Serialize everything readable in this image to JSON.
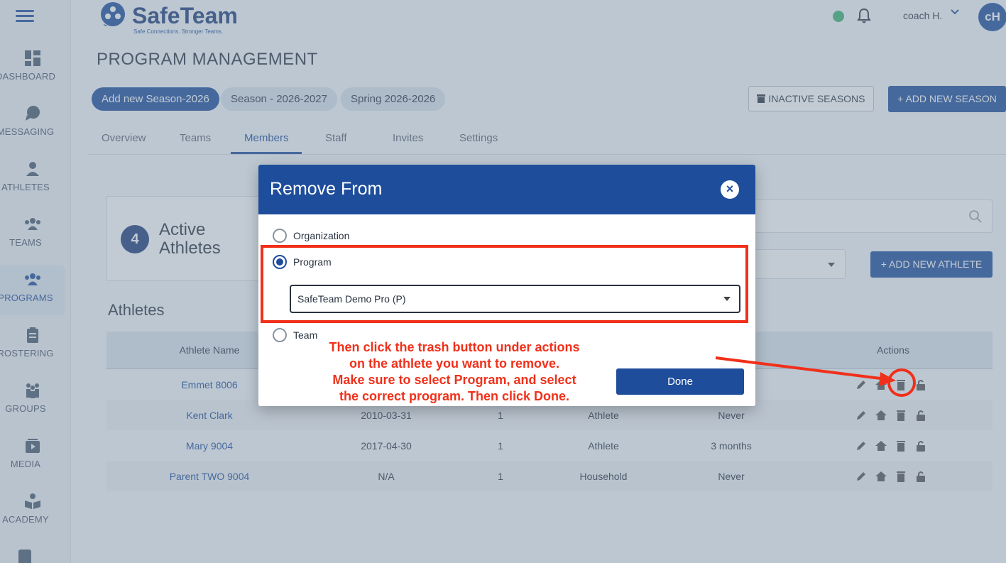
{
  "sidebar": {
    "items": [
      {
        "label": "DASHBOARD",
        "icon": "dashboard-icon"
      },
      {
        "label": "MESSAGING",
        "icon": "messaging-icon"
      },
      {
        "label": "ATHLETES",
        "icon": "athlete-icon"
      },
      {
        "label": "TEAMS",
        "icon": "teams-icon"
      },
      {
        "label": "PROGRAMS",
        "icon": "programs-icon",
        "active": true
      },
      {
        "label": "ROSTERING",
        "icon": "clipboard-icon"
      },
      {
        "label": "GROUPS",
        "icon": "groups-icon"
      },
      {
        "label": "MEDIA",
        "icon": "media-icon"
      },
      {
        "label": "ACADEMY",
        "icon": "academy-icon"
      }
    ]
  },
  "header": {
    "logo_text": "SafeTeam",
    "logo_tagline": "Safe Connections. Stronger Teams.",
    "user_name": "coach H.",
    "avatar_initials": "cH",
    "status_color": "#3cb371"
  },
  "page": {
    "title": "PROGRAM MANAGEMENT",
    "season_chips": [
      "Add new Season-2026",
      "Season - 2026-2027",
      "Spring 2026-2026"
    ],
    "inactive_seasons_label": "INACTIVE SEASONS",
    "add_season_label": "+ ADD NEW SEASON",
    "tabs": [
      "Overview",
      "Teams",
      "Members",
      "Staff",
      "Invites",
      "Settings"
    ],
    "active_tab": "Members",
    "active_count": "4",
    "active_label_line1": "Active",
    "active_label_line2": "Athletes",
    "add_athlete_label": "+ ADD NEW ATHLETE",
    "section_title": "Athletes"
  },
  "table": {
    "headers": {
      "name": "Athlete Name",
      "actions": "Actions"
    },
    "rows": [
      {
        "name": "Emmet 8006",
        "dob": "",
        "count": "",
        "role": "",
        "last": ""
      },
      {
        "name": "Kent Clark",
        "dob": "2010-03-31",
        "count": "1",
        "role": "Athlete",
        "last": "Never"
      },
      {
        "name": "Mary 9004",
        "dob": "2017-04-30",
        "count": "1",
        "role": "Athlete",
        "last": "3 months"
      },
      {
        "name": "Parent TWO 9004",
        "dob": "N/A",
        "count": "1",
        "role": "Household",
        "last": "Never"
      }
    ]
  },
  "modal": {
    "title": "Remove From",
    "close_icon": "close-icon",
    "options": [
      "Organization",
      "Program",
      "Team"
    ],
    "selected_option": "Program",
    "program_value": "SafeTeam Demo Pro (P)",
    "done_label": "Done"
  },
  "annotation": {
    "lines": [
      "Then click the trash button under actions",
      "on the athlete you want to remove.",
      "Make sure to select Program, and select",
      "the correct program. Then click Done."
    ],
    "color": "#f0301a"
  }
}
